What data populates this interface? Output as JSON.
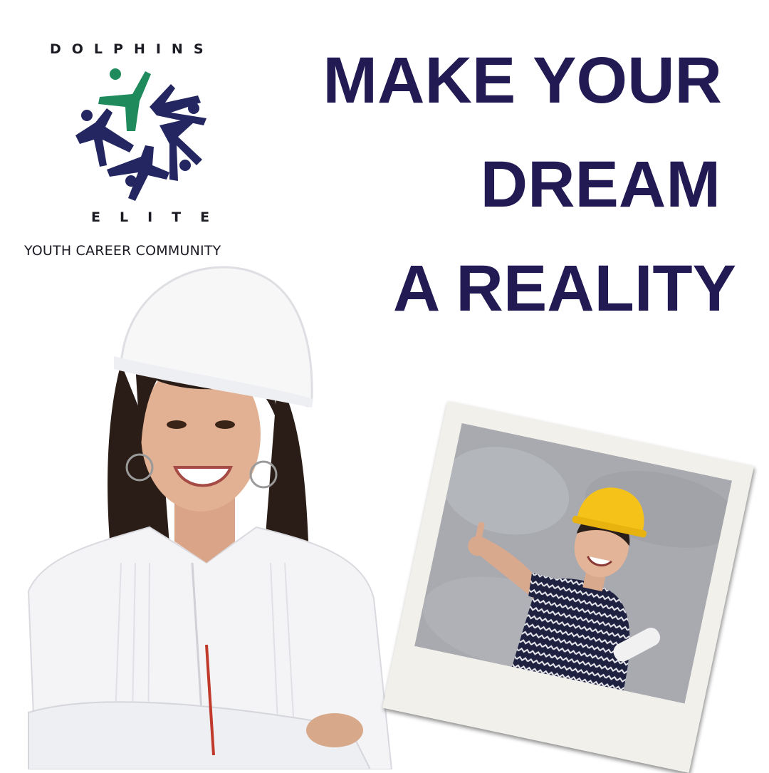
{
  "brand": {
    "name_top": "DOLPHINS",
    "name_bottom": "ELITE",
    "tagline": "YOUTH CAREER COMMUNITY",
    "colors": {
      "navy": "#232660",
      "green": "#1f8a5c",
      "text": "#1b1b24"
    },
    "icon": "five-figures-circle-logo"
  },
  "headline": {
    "lines": [
      "MAKE YOUR",
      "DREAM",
      "A REALITY"
    ],
    "color": "#221a52"
  },
  "photos": {
    "woman": "woman-in-white-hard-hat-photo",
    "polaroid": "boy-in-yellow-hard-hat-thumbs-up-photo"
  }
}
